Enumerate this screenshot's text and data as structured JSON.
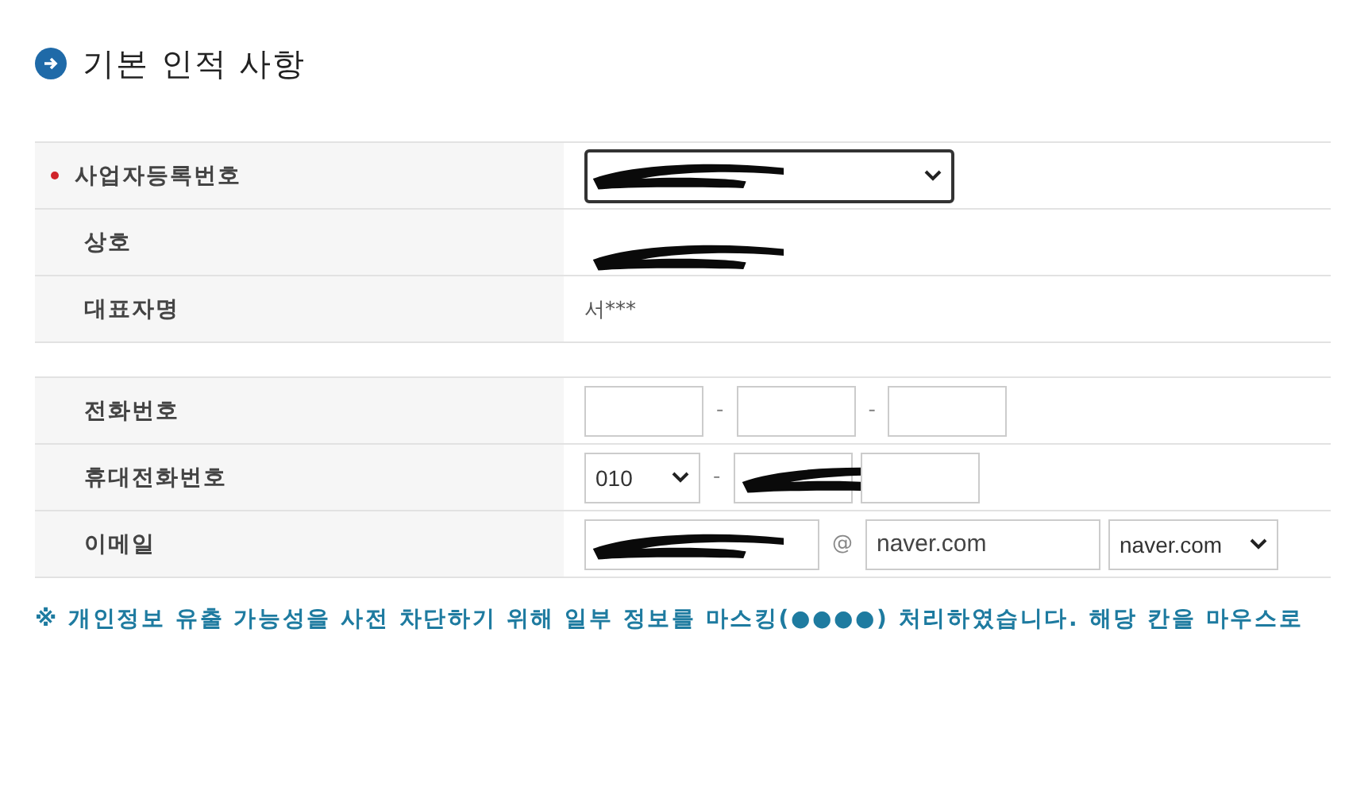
{
  "section": {
    "title": "기본 인적 사항"
  },
  "tables": [
    {
      "rows": [
        {
          "label": "사업자등록번호",
          "required": true,
          "kind": "single",
          "controls": [
            {
              "kind": "select",
              "redacted": true
            }
          ]
        },
        {
          "label": "상호",
          "required": false,
          "controls": [
            {
              "kind": "text",
              "redacted": true
            }
          ]
        },
        {
          "label": "대표자명",
          "required": false,
          "controls": [
            {
              "kind": "text",
              "value": "서***",
              "redacted": false
            }
          ]
        }
      ]
    },
    {
      "rows": [
        {
          "label": "전화번호",
          "required": false,
          "kind": "phone",
          "controls": [
            {
              "kind": "input",
              "redacted": false
            },
            {
              "kind": "separator",
              "value": "-"
            },
            {
              "kind": "input",
              "redacted": false
            },
            {
              "kind": "separator",
              "value": "-"
            },
            {
              "kind": "input",
              "redacted": false
            }
          ]
        },
        {
          "label": "휴대전화번호",
          "required": false,
          "kind": "phone",
          "controls": [
            {
              "kind": "select",
              "value": "010",
              "redacted": false
            },
            {
              "kind": "separator",
              "value": "-"
            },
            {
              "kind": "input",
              "redacted": true
            },
            {
              "kind": "input",
              "redacted": false
            }
          ]
        },
        {
          "label": "이메일",
          "required": false,
          "kind": "email",
          "controls": [
            {
              "kind": "input",
              "redacted": true
            },
            {
              "kind": "separator",
              "value": "@"
            },
            {
              "kind": "input",
              "value": "naver.com",
              "redacted": false
            },
            {
              "kind": "select",
              "value": "naver.com",
              "redacted": false
            }
          ]
        }
      ]
    }
  ],
  "notice": "※ 개인정보 유출 가능성을 사전 차단하기 위해 일부 정보를 마스킹(●●●●) 처리하였습니다. 해당 칸을 마우스로"
}
